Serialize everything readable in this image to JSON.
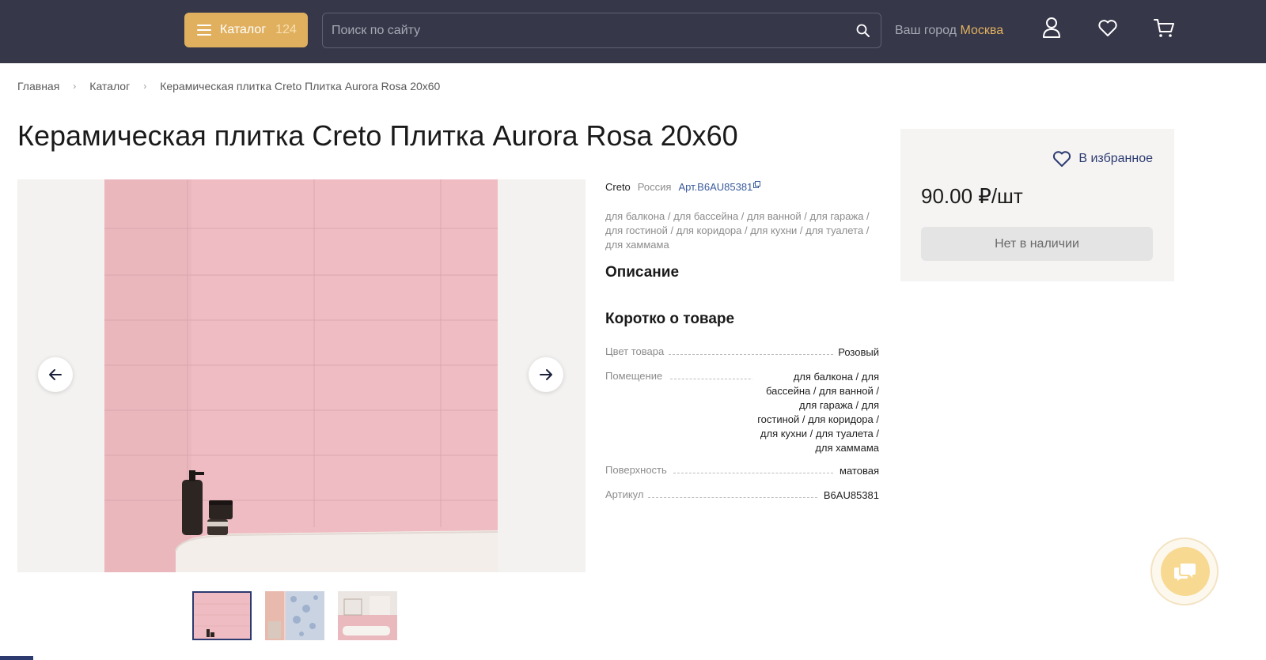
{
  "header": {
    "catalog_label": "Каталог",
    "catalog_count": "124",
    "search_placeholder": "Поиск по сайту",
    "city_label": "Ваш город",
    "city_name": "Москва",
    "icons": [
      "user-icon",
      "heart-icon",
      "cart-icon"
    ]
  },
  "breadcrumb": {
    "home": "Главная",
    "catalog": "Каталог",
    "current": "Керамическая плитка Creto Плитка Aurora Rosa 20x60"
  },
  "product": {
    "title": "Керамическая плитка Creto Плитка Aurora Rosa 20x60",
    "brand": "Creto",
    "country": "Россия",
    "article_link": "Арт.B6AU85381",
    "rooms": "для балкона / для бассейна / для ванной / для гаража / для гостиной / для коридора / для кухни / для туалета / для хаммама",
    "description_heading": "Описание",
    "short_heading": "Коротко о товаре",
    "specs": [
      {
        "label": "Цвет товара",
        "value": "Розовый"
      },
      {
        "label": "Помещение",
        "value": "для балкона / для бассейна / для ванной / для гаража / для гостиной / для коридора / для кухни / для туалета / для хаммама"
      },
      {
        "label": "Поверхность",
        "value": "матовая"
      },
      {
        "label": "Артикул",
        "value": "B6AU85381"
      }
    ]
  },
  "buybox": {
    "favorite_label": "В избранное",
    "price": "90.00 ₽/шт",
    "stock_button": "Нет в наличии"
  },
  "colors": {
    "header_bg": "#363749",
    "accent": "#e0b05f",
    "tile_pink": "#eebcc2",
    "link_blue": "#3a5b9c"
  }
}
